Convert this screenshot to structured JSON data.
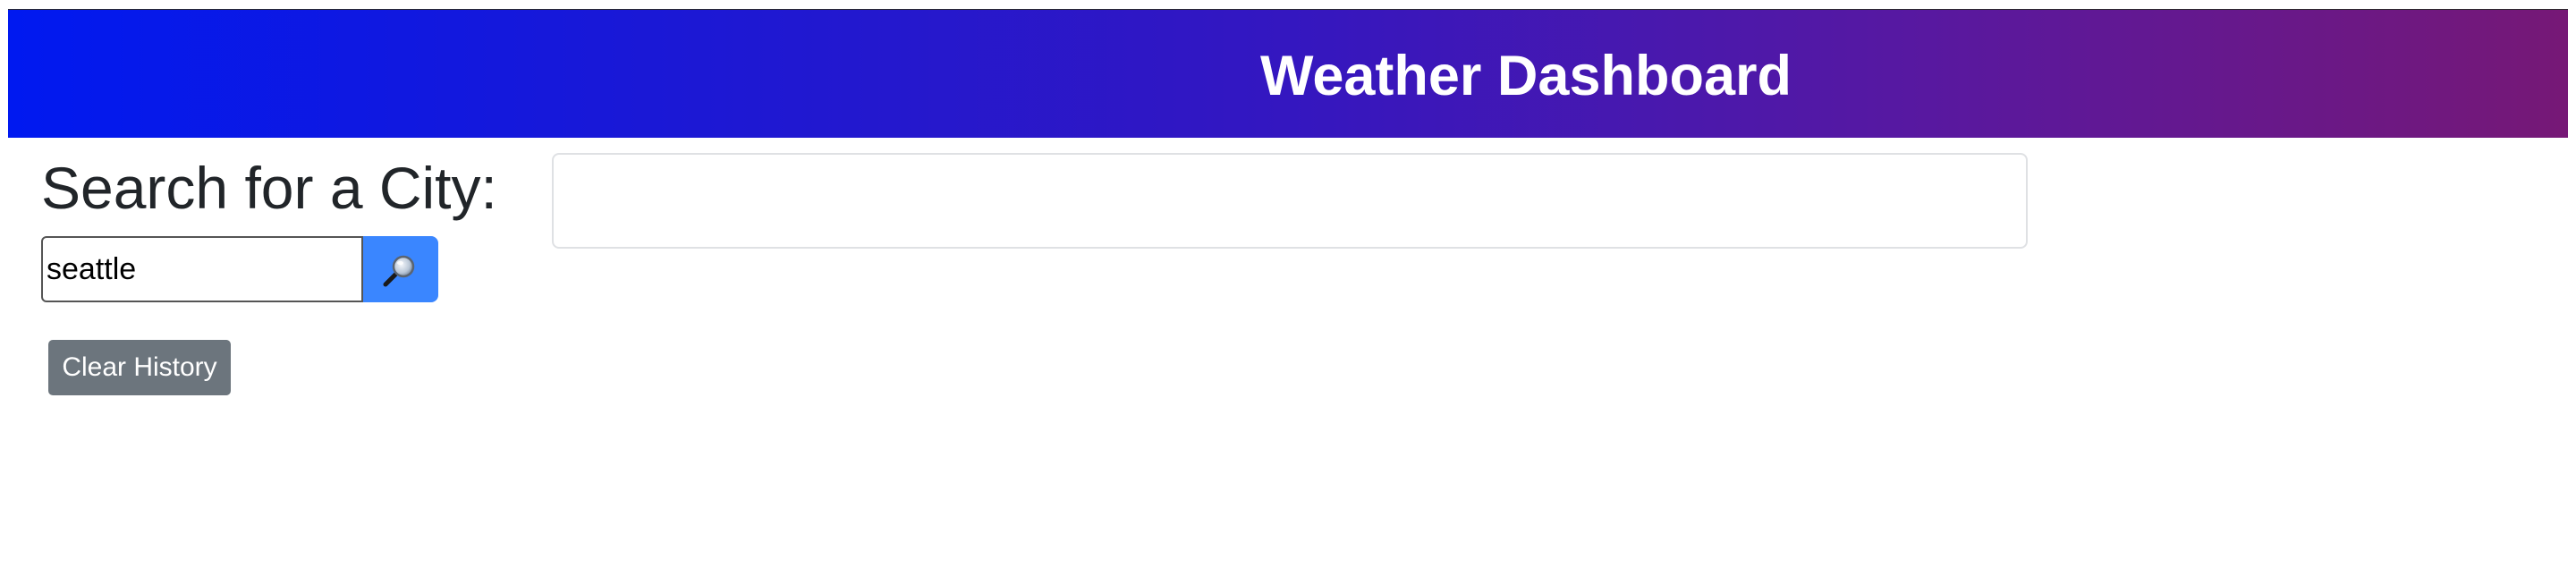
{
  "header": {
    "title": "Weather Dashboard",
    "gradient_start": "#0019f0",
    "gradient_end": "#761876"
  },
  "search": {
    "heading": "Search for a City:",
    "input_value": "seattle",
    "button_icon": "magnifying-glass-icon",
    "button_color": "#3a86ff"
  },
  "history": {
    "clear_label": "Clear History",
    "button_color": "#6c757d"
  },
  "current_weather": {
    "content": ""
  }
}
